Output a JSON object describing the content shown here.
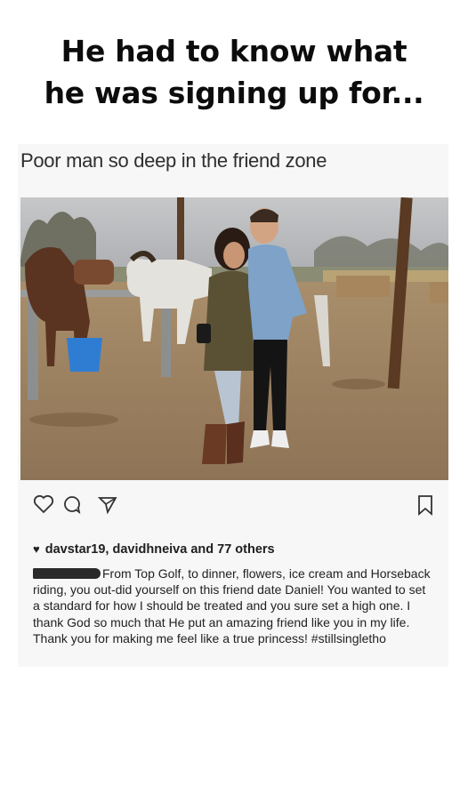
{
  "meme": {
    "title_line1": "He had to know what",
    "title_line2": "he was signing up for..."
  },
  "post": {
    "caption_top": "Poor man so deep in the friend zone",
    "photo_alt": "photo",
    "actions": {
      "like_icon": "heart-outline-icon",
      "comment_icon": "comment-bubble-icon",
      "share_icon": "send-arrow-icon",
      "save_icon": "bookmark-icon"
    },
    "likes_text": "davstar19, davidhneiva and 77 others",
    "text": "From Top Golf, to dinner, flowers, ice cream and Horseback riding, you out-did yourself on this friend date Daniel! You wanted to set a standard for how I should be treated and you sure set a high one. I thank God so much that He put an amazing friend like you in my life. Thank you for making me feel like a true princess! #stillsingletho"
  }
}
